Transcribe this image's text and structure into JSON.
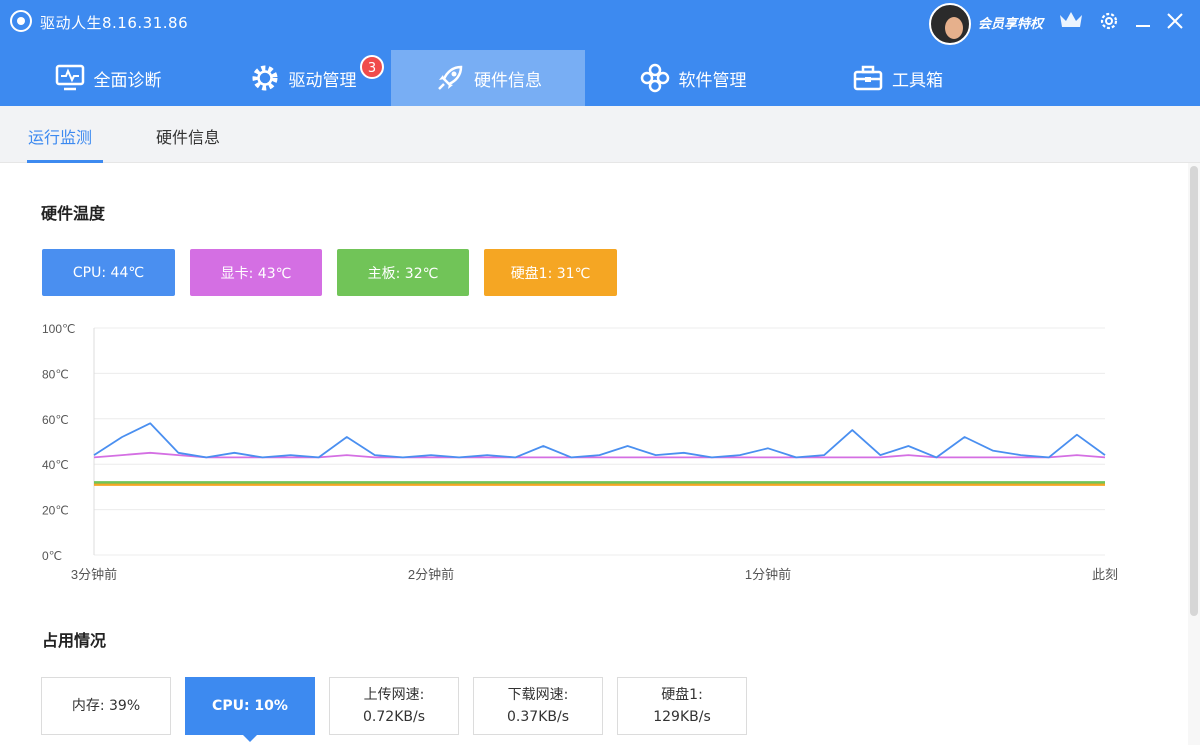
{
  "app": {
    "title": "驱动人生8.16.31.86",
    "vip_label": "会员享特权"
  },
  "nav": {
    "tabs": [
      {
        "label": "全面诊断",
        "icon": "monitor-icon"
      },
      {
        "label": "驱动管理",
        "icon": "gear-icon",
        "badge": "3"
      },
      {
        "label": "硬件信息",
        "icon": "rocket-icon",
        "active": true
      },
      {
        "label": "软件管理",
        "icon": "apps-icon"
      },
      {
        "label": "工具箱",
        "icon": "toolbox-icon"
      }
    ]
  },
  "subtabs": [
    {
      "label": "运行监测",
      "active": true
    },
    {
      "label": "硬件信息"
    }
  ],
  "temperature": {
    "title": "硬件温度",
    "cards": [
      {
        "label": "CPU: 44℃",
        "color": "#4a8ff0"
      },
      {
        "label": "显卡: 43℃",
        "color": "#d46fe3"
      },
      {
        "label": "主板: 32℃",
        "color": "#71c458"
      },
      {
        "label": "硬盘1: 31℃",
        "color": "#f5a623"
      }
    ]
  },
  "chart_data": {
    "type": "line",
    "ylim": [
      0,
      100
    ],
    "y_ticks": [
      "100℃",
      "80℃",
      "60℃",
      "40℃",
      "20℃",
      "0℃"
    ],
    "x_ticks": [
      "3分钟前",
      "2分钟前",
      "1分钟前",
      "此刻"
    ],
    "x": [
      0,
      5,
      10,
      15,
      20,
      25,
      30,
      35,
      40,
      45,
      50,
      55,
      60,
      65,
      70,
      75,
      80,
      85,
      90,
      95,
      100,
      105,
      110,
      115,
      120,
      125,
      130,
      135,
      140,
      145,
      150,
      155,
      160,
      165,
      170,
      175,
      180
    ],
    "series": [
      {
        "name": "CPU",
        "color": "#4a8ff0",
        "values": [
          44,
          52,
          58,
          45,
          43,
          45,
          43,
          44,
          43,
          52,
          44,
          43,
          44,
          43,
          44,
          43,
          48,
          43,
          44,
          48,
          44,
          45,
          43,
          44,
          47,
          43,
          44,
          55,
          44,
          48,
          43,
          52,
          46,
          44,
          43,
          53,
          44
        ]
      },
      {
        "name": "显卡",
        "color": "#d46fe3",
        "values": [
          43,
          44,
          45,
          44,
          43,
          43,
          43,
          43,
          43,
          44,
          43,
          43,
          43,
          43,
          43,
          43,
          43,
          43,
          43,
          43,
          43,
          43,
          43,
          43,
          43,
          43,
          43,
          43,
          43,
          44,
          43,
          43,
          43,
          43,
          43,
          44,
          43
        ]
      },
      {
        "name": "主板",
        "color": "#71c458",
        "values": [
          32,
          32,
          32,
          32,
          32,
          32,
          32,
          32,
          32,
          32,
          32,
          32,
          32,
          32,
          32,
          32,
          32,
          32,
          32,
          32,
          32,
          32,
          32,
          32,
          32,
          32,
          32,
          32,
          32,
          32,
          32,
          32,
          32,
          32,
          32,
          32,
          32
        ]
      },
      {
        "name": "硬盘1",
        "color": "#f5a623",
        "values": [
          31,
          31,
          31,
          31,
          31,
          31,
          31,
          31,
          31,
          31,
          31,
          31,
          31,
          31,
          31,
          31,
          31,
          31,
          31,
          31,
          31,
          31,
          31,
          31,
          31,
          31,
          31,
          31,
          31,
          31,
          31,
          31,
          31,
          31,
          31,
          31,
          31
        ]
      }
    ]
  },
  "usage": {
    "title": "占用情况",
    "boxes": [
      {
        "line1": "内存: 39%",
        "line2": ""
      },
      {
        "line1": "CPU: 10%",
        "line2": "",
        "active": true
      },
      {
        "line1": "上传网速:",
        "line2": "0.72KB/s"
      },
      {
        "line1": "下载网速:",
        "line2": "0.37KB/s"
      },
      {
        "line1": "硬盘1:",
        "line2": "129KB/s"
      }
    ]
  }
}
